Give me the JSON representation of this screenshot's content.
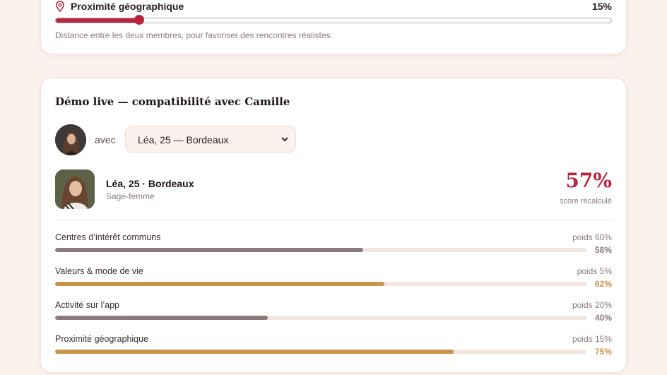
{
  "colors": {
    "accent": "#b8233e",
    "bar_mauve": "#8c7a7f",
    "bar_gold": "#c9954a",
    "background": "#fcf1ec"
  },
  "proximity_setting": {
    "icon": "map-pin-icon",
    "title": "Proximité géographique",
    "value_label": "15%",
    "value": 15,
    "description": "Distance entre les deux membres, pour favoriser des rencontres réalistes."
  },
  "demo": {
    "title": "Démo live — compatibilité avec Camille",
    "with_label": "avec",
    "selected_member": "Léa, 25 — Bordeaux",
    "profile": {
      "name": "Léa, 25 · Bordeaux",
      "job": "Sage-femme"
    },
    "score": "57%",
    "score_caption": "score recalculé",
    "criteria": [
      {
        "label": "Centres d’intérêt communs",
        "weight": "poids 60%",
        "score": "58%",
        "value": 58,
        "color": "#8c7a7f"
      },
      {
        "label": "Valeurs & mode de vie",
        "weight": "poids 5%",
        "score": "62%",
        "value": 62,
        "color": "#c9954a"
      },
      {
        "label": "Activité sur l’app",
        "weight": "poids 20%",
        "score": "40%",
        "value": 40,
        "color": "#8c7a7f"
      },
      {
        "label": "Proximité géographique",
        "weight": "poids 15%",
        "score": "75%",
        "value": 75,
        "color": "#c9954a"
      }
    ]
  }
}
